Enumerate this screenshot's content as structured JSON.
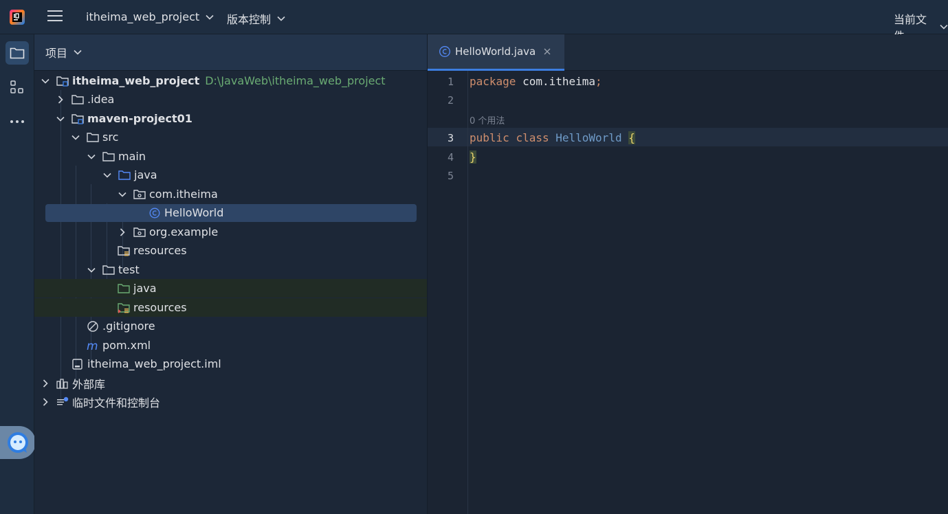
{
  "topbar": {
    "project_name": "itheima_web_project",
    "vcs_label": "版本控制",
    "current_file_label": "当前文件"
  },
  "panel": {
    "title": "项目"
  },
  "tree": [
    {
      "label": "itheima_web_project",
      "path": "D:\\JavaWeb\\itheima_web_project"
    },
    {
      "label": ".idea"
    },
    {
      "label": "maven-project01"
    },
    {
      "label": "src"
    },
    {
      "label": "main"
    },
    {
      "label": "java"
    },
    {
      "label": "com.itheima"
    },
    {
      "label": "HelloWorld"
    },
    {
      "label": "org.example"
    },
    {
      "label": "resources"
    },
    {
      "label": "test"
    },
    {
      "label": "java"
    },
    {
      "label": "resources"
    },
    {
      "label": ".gitignore"
    },
    {
      "label": "pom.xml"
    },
    {
      "label": "itheima_web_project.iml"
    },
    {
      "label": "外部库"
    },
    {
      "label": "临时文件和控制台"
    }
  ],
  "editor": {
    "tab_label": "HelloWorld.java",
    "line_numbers": [
      "1",
      "2",
      "3",
      "4",
      "5"
    ],
    "usage_hint": "0 个用法",
    "code": {
      "line1_kw": "package",
      "line1_pkg": "com.itheima",
      "line1_semi": ";",
      "line3_kw1": "public",
      "line3_kw2": "class",
      "line3_cls": "HelloWorld",
      "line3_brace": "{",
      "line4_brace": "}"
    }
  },
  "colors": {
    "accent": "#3c7de0",
    "selection": "#2e4566",
    "path_green": "#6aab73",
    "keyword": "#cf8e6d"
  }
}
